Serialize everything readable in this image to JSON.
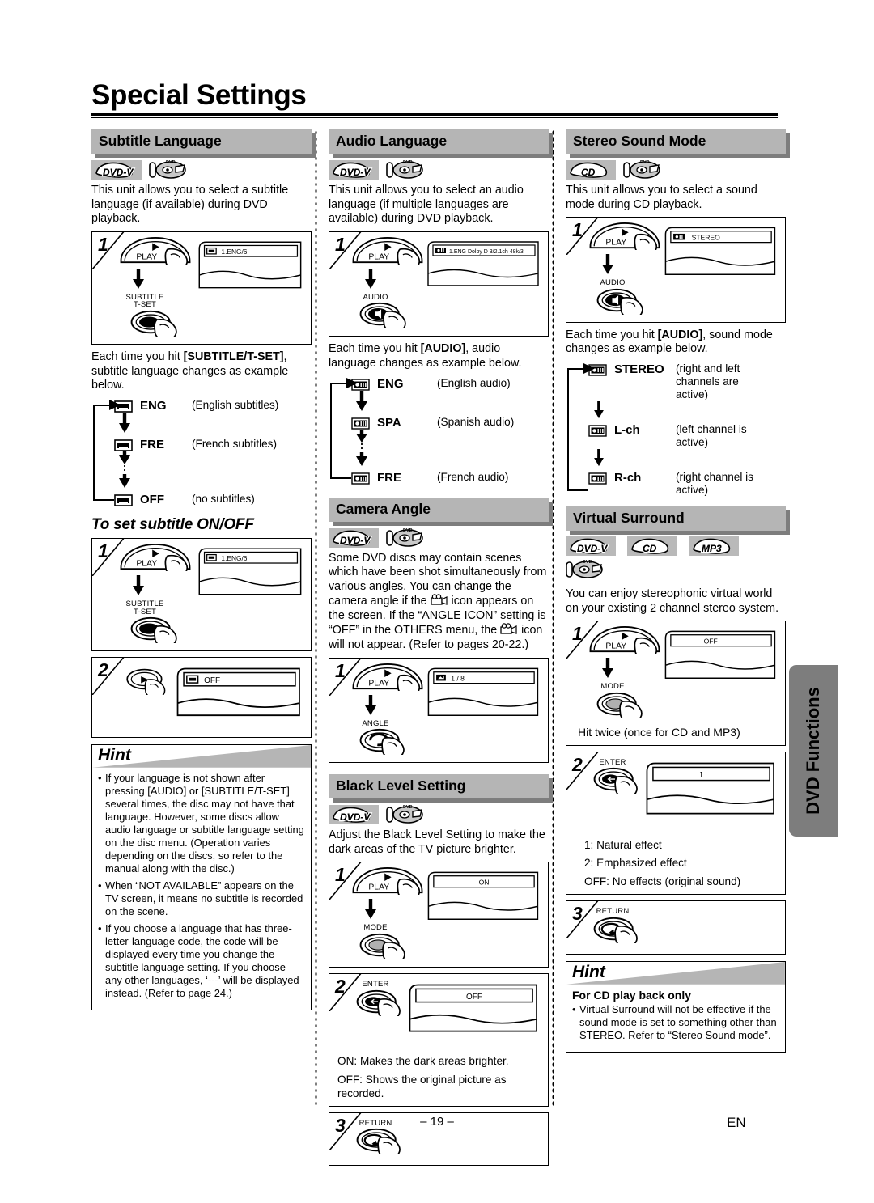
{
  "page": {
    "title": "Special Settings",
    "page_number": "– 19 –",
    "language_mark": "EN",
    "side_tab": "DVD Functions"
  },
  "subtitle_language": {
    "heading": "Subtitle Language",
    "badges": [
      "DVD-V"
    ],
    "intro": "This unit allows you to select a subtitle language (if available) during DVD playback.",
    "step1": {
      "num": "1",
      "play_label": "PLAY",
      "key_label_line1": "SUBTITLE",
      "key_label_line2": "T-SET",
      "osd_text": "1.ENG/6"
    },
    "after_text_a": "Each time you hit ",
    "after_text_b": "[SUBTITLE/T-SET]",
    "after_text_c": ", subtitle language changes as example below.",
    "sequence": [
      {
        "code": "ENG",
        "desc": "(English subtitles)"
      },
      {
        "code": "FRE",
        "desc": "(French subtitles)"
      },
      {
        "code": "OFF",
        "desc": "(no subtitles)"
      }
    ],
    "onoff_heading": "To set subtitle ON/OFF",
    "onoff_step1": {
      "num": "1",
      "play_label": "PLAY",
      "key_label_line1": "SUBTITLE",
      "key_label_line2": "T-SET",
      "osd_text": "1.ENG/6"
    },
    "onoff_step2": {
      "num": "2",
      "osd_text": "OFF"
    },
    "hint": {
      "title": "Hint",
      "items": [
        "If your language is not shown after pressing [AUDIO] or [SUBTITLE/T-SET] several times, the disc may not have that language. However, some discs allow audio language or subtitle language setting on the disc menu. (Operation varies depending on the discs, so refer to the manual along with the disc.)",
        "When “NOT AVAILABLE” appears on the TV screen, it means no subtitle is recorded on the scene.",
        "If you choose a language that has three-letter-language code, the code will be displayed every time you change the subtitle language setting. If you choose any other languages, ‘---’ will be displayed instead. (Refer to page 24.)"
      ]
    }
  },
  "audio_language": {
    "heading": "Audio Language",
    "badges": [
      "DVD-V"
    ],
    "intro": "This unit allows you to select an audio language (if multiple languages are available) during DVD playback.",
    "step1": {
      "num": "1",
      "play_label": "PLAY",
      "key_label": "AUDIO",
      "osd_text": "1.ENG  Dolby D  3/2.1ch  48k/3"
    },
    "after_text_a": "Each time you hit ",
    "after_text_b": "[AUDIO]",
    "after_text_c": ", audio language changes as example below.",
    "sequence": [
      {
        "code": "ENG",
        "desc": "(English audio)"
      },
      {
        "code": "SPA",
        "desc": "(Spanish audio)"
      },
      {
        "code": "FRE",
        "desc": "(French audio)"
      }
    ]
  },
  "camera_angle": {
    "heading": "Camera Angle",
    "badges": [
      "DVD-V"
    ],
    "intro_part1": "Some DVD discs may contain scenes which have been shot simultaneously from various angles. You can change the camera angle if the ",
    "intro_part2": " icon appears on the screen. If the “ANGLE ICON” setting is “OFF” in the OTHERS menu, the ",
    "intro_part3": " icon will not appear. (Refer to pages 20-22.)",
    "step1": {
      "num": "1",
      "play_label": "PLAY",
      "key_label": "ANGLE",
      "osd_text": "1 / 8"
    }
  },
  "black_level": {
    "heading": "Black Level Setting",
    "badges": [
      "DVD-V"
    ],
    "intro": "Adjust the Black Level Setting to make the dark areas of the TV picture brighter.",
    "step1": {
      "num": "1",
      "play_label": "PLAY",
      "key_label": "MODE",
      "osd_text": "ON"
    },
    "step2": {
      "num": "2",
      "key_label": "ENTER",
      "osd_text": "OFF",
      "note_line1": "ON: Makes the dark areas brighter.",
      "note_line2": "OFF: Shows the original picture as recorded."
    },
    "step3": {
      "num": "3",
      "key_label": "RETURN"
    }
  },
  "stereo_sound": {
    "heading": "Stereo Sound Mode",
    "badges": [
      "CD"
    ],
    "intro": "This unit allows you to select a sound mode during CD playback.",
    "step1": {
      "num": "1",
      "play_label": "PLAY",
      "key_label": "AUDIO",
      "osd_text": "STEREO"
    },
    "after_text_a": "Each time you hit ",
    "after_text_b": "[AUDIO]",
    "after_text_c": ", sound mode changes as example below.",
    "sequence": [
      {
        "code": "STEREO",
        "desc": "(right and left channels are active)"
      },
      {
        "code": "L-ch",
        "desc": "(left channel is active)"
      },
      {
        "code": "R-ch",
        "desc": "(right channel is active)"
      }
    ]
  },
  "virtual_surround": {
    "heading": "Virtual Surround",
    "badges": [
      "DVD-V",
      "CD",
      "MP3"
    ],
    "intro": "You can enjoy stereophonic virtual world on your existing 2 channel stereo system.",
    "step1": {
      "num": "1",
      "play_label": "PLAY",
      "key_label": "MODE",
      "osd_text": "OFF",
      "note": "Hit twice (once for CD and MP3)"
    },
    "step2": {
      "num": "2",
      "key_label": "ENTER",
      "osd_text": "1",
      "note_line1": "1: Natural effect",
      "note_line2": "2: Emphasized effect",
      "note_line3": "OFF: No effects (original sound)"
    },
    "step3": {
      "num": "3",
      "key_label": "RETURN"
    },
    "hint": {
      "title": "Hint",
      "subtitle": "For CD play back only",
      "items": [
        "Virtual Surround will not be effective if the sound mode is set to something other than STEREO. Refer to “Stereo Sound mode”."
      ]
    }
  },
  "colors": {
    "header_bar": "#b5b5b5",
    "header_shadow": "#7d7d7d",
    "side_tab": "#7d7d7d"
  }
}
